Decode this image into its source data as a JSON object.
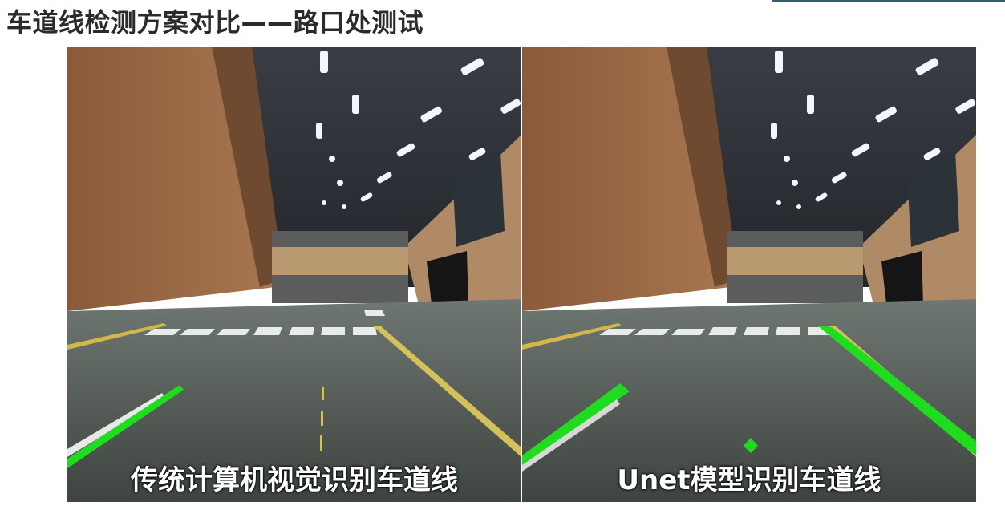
{
  "slide": {
    "title": "车道线检测方案对比——路口处测试"
  },
  "panels": [
    {
      "caption": "传统计算机视觉识别车道线",
      "scene_icon": "indoor-track-scene",
      "overlay_color": "#1fdc1f"
    },
    {
      "caption": "Unet模型识别车道线",
      "scene_icon": "indoor-track-scene",
      "overlay_color": "#1fdc1f"
    }
  ]
}
